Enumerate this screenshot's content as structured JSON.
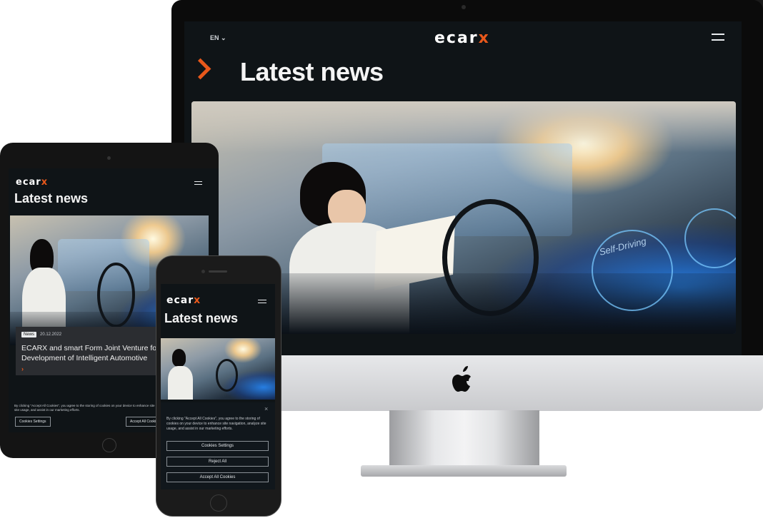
{
  "brand": {
    "logo_text": "ecar",
    "logo_accent": "x",
    "accent_color": "#e8581b",
    "bg_color": "#0f1417"
  },
  "desktop": {
    "language": "EN ⌄",
    "heading": "Latest news",
    "hero_labels": [
      "Self-Driving"
    ]
  },
  "tablet": {
    "heading": "Latest news",
    "news_tag": "News",
    "news_date": "20.12.2022",
    "news_title": "ECARX and smart Form Joint Venture for Development of Intelligent Automotive",
    "news_arrow": "›",
    "cookie_text": "By clicking \"Accept All Cookies\", you agree to the storing of cookies on your device to enhance site navigation, analyze site usage, and assist in our marketing efforts.",
    "cookie_settings": "Cookies Settings",
    "accept_all": "Accept All Cookies"
  },
  "phone": {
    "heading": "Latest news",
    "cookie_close": "×",
    "cookie_text": "By clicking \"Accept All Cookies\", you agree to the storing of cookies on your device to enhance site navigation, analyze site usage, and assist in our marketing efforts.",
    "cookie_settings": "Cookies Settings",
    "reject_all": "Reject All",
    "accept_all": "Accept All Cookies"
  },
  "icons": [
    "apple-logo-icon",
    "menu-icon",
    "chevron-right-icon",
    "close-icon"
  ]
}
